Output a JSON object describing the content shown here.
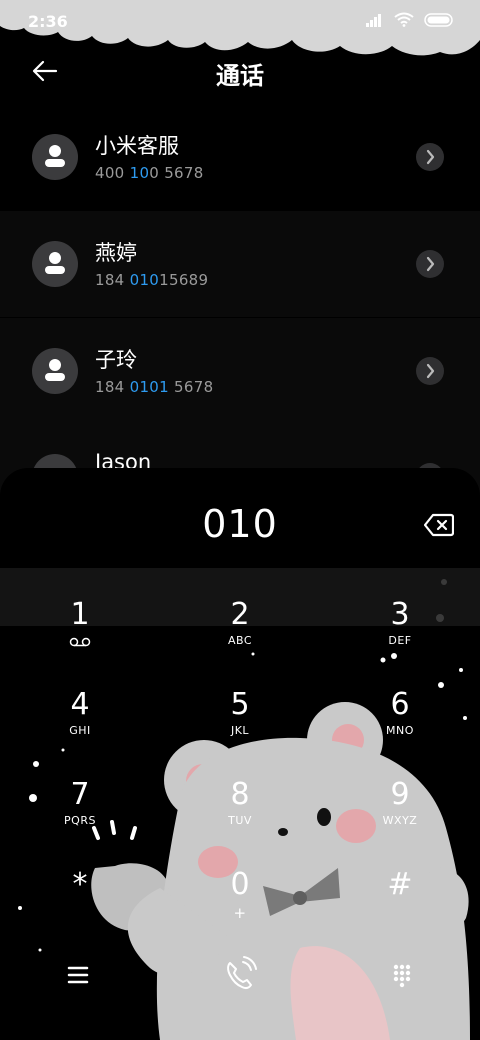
{
  "status_bar": {
    "time": "2:36"
  },
  "header": {
    "title": "通话"
  },
  "contacts": [
    {
      "name": "小米客服",
      "num_a": "400 ",
      "num_hl": "10",
      "num_b": "0 5678"
    },
    {
      "name": "燕婷",
      "num_a": "184 ",
      "num_hl": "010",
      "num_b": "15689"
    },
    {
      "name": "子玲",
      "num_a": "184 ",
      "num_hl": "0101",
      "num_b": " 5678"
    },
    {
      "name": "Jason"
    }
  ],
  "dialer": {
    "number": "010",
    "keys": [
      {
        "digit": "1",
        "letters": ""
      },
      {
        "digit": "2",
        "letters": "ABC"
      },
      {
        "digit": "3",
        "letters": "DEF"
      },
      {
        "digit": "4",
        "letters": "GHI"
      },
      {
        "digit": "5",
        "letters": "JKL"
      },
      {
        "digit": "6",
        "letters": "MNO"
      },
      {
        "digit": "7",
        "letters": "PQRS"
      },
      {
        "digit": "8",
        "letters": "TUV"
      },
      {
        "digit": "9",
        "letters": "WXYZ"
      },
      {
        "digit": "*",
        "letters": ""
      },
      {
        "digit": "0",
        "letters": "+"
      },
      {
        "digit": "#",
        "letters": ""
      }
    ]
  },
  "colors": {
    "highlight": "#2e9bf0",
    "background": "#000000",
    "cloud": "#d6d6d6"
  },
  "icons": {
    "back": "arrow-left-icon",
    "backspace": "backspace-icon",
    "menu": "menu-icon",
    "call": "call-icon",
    "dialpad": "dialpad-icon"
  }
}
